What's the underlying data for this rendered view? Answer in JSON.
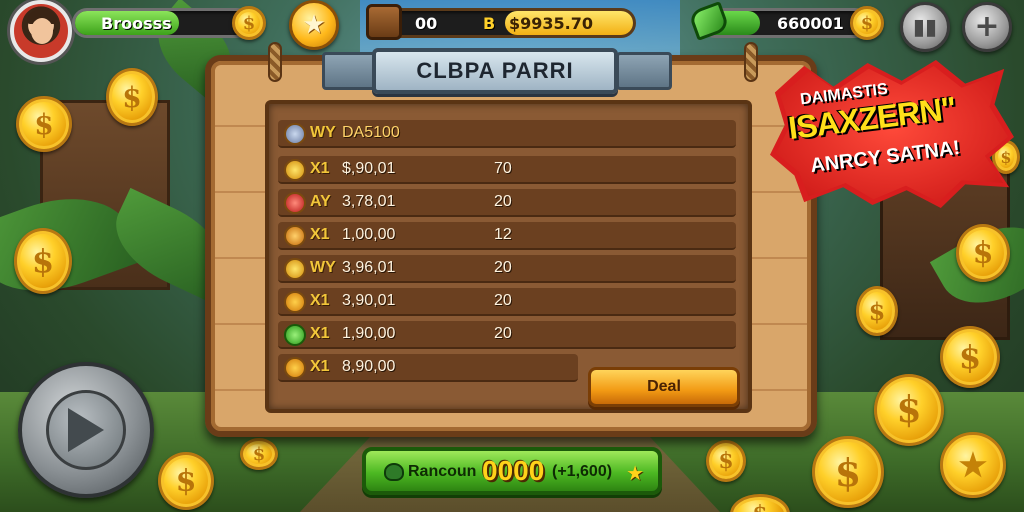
{
  "hud": {
    "player_bar_label": "Broosss",
    "gold_counter": "00",
    "gold_bar_label": "$9935.70",
    "gold_bar_prefix": "B",
    "gems_value": "660001",
    "player_bar_progress": 0.6,
    "gold_bar_progress": 0.58,
    "gems_bar_progress": 0.35
  },
  "panel": {
    "title": "CLBPA PARRI",
    "header": {
      "tag": "WY",
      "text": "DA5100"
    },
    "rows": [
      {
        "tag": "X1",
        "value": "$,90,01",
        "count": "70",
        "icon": "gold-coin-icon"
      },
      {
        "tag": "AY",
        "value": "3,78,01",
        "count": "20",
        "icon": "red-gem-icon"
      },
      {
        "tag": "X1",
        "value": "1,00,00",
        "count": "12",
        "icon": "shield-icon"
      },
      {
        "tag": "WY",
        "value": "3,96,01",
        "count": "20",
        "icon": "gold-coin-icon"
      },
      {
        "tag": "X1",
        "value": "3,90,01",
        "count": "20",
        "icon": "gold-coin-icon"
      },
      {
        "tag": "X1",
        "value": "1,90,00",
        "count": "20",
        "icon": "green-gem-icon"
      },
      {
        "tag": "X1",
        "value": "8,90,00",
        "count": "",
        "icon": "gold-coin-icon"
      }
    ],
    "deal_button": "Deal"
  },
  "reward_button": {
    "label": "Rancoun",
    "amount": "0000",
    "sub": "(+1,600)"
  },
  "banner": {
    "line1": "DAIMASTIS",
    "line2": "ISAXZERN\"",
    "line3": "ANRCY SATNA!"
  },
  "colors": {
    "wood": "#d9a66a",
    "panel_row": "#6b4020",
    "gold": "#ffd02a",
    "green_button": "#4cb822",
    "banner_red": "#d81e1e",
    "orange_button": "#f29a14"
  }
}
